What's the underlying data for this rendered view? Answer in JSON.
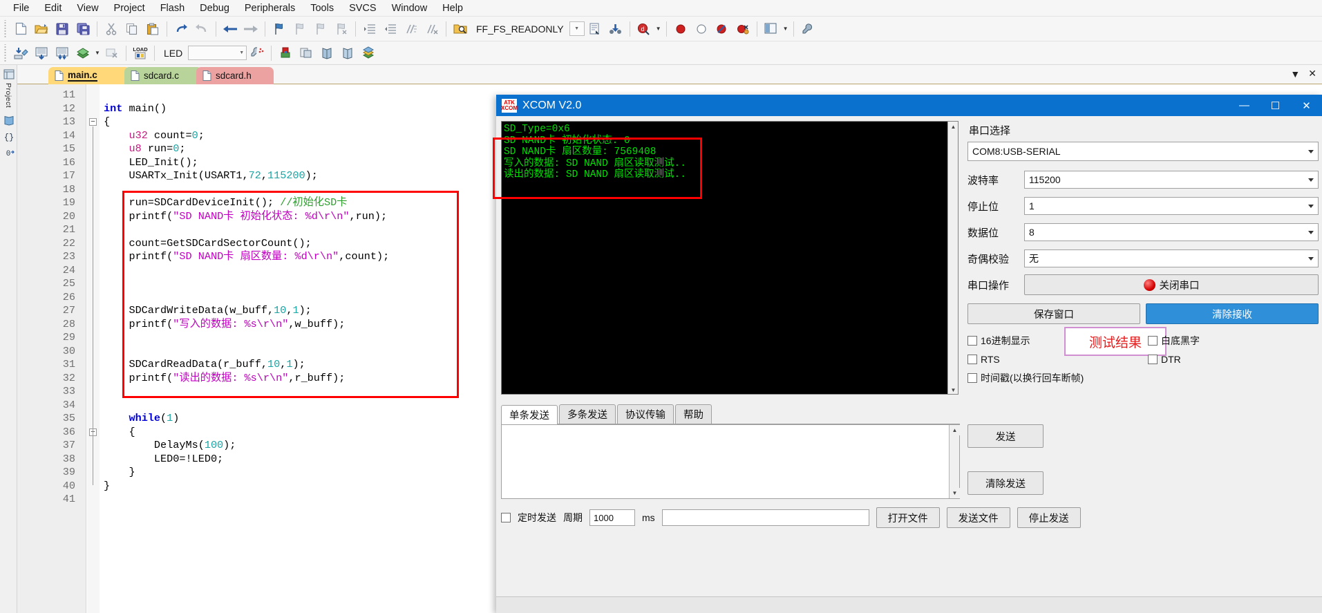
{
  "menubar": {
    "items": [
      "File",
      "Edit",
      "View",
      "Project",
      "Flash",
      "Debug",
      "Peripherals",
      "Tools",
      "SVCS",
      "Window",
      "Help"
    ]
  },
  "toolbar1": {
    "define_label": "FF_FS_READONLY",
    "icons": [
      "new-file-icon",
      "open-folder-icon",
      "save-icon",
      "save-all-icon",
      "cut-icon",
      "copy-icon",
      "paste-icon",
      "undo-icon",
      "redo-icon",
      "navigate-back-icon",
      "navigate-forward-icon",
      "bookmark-toggle-icon",
      "bookmark-prev-icon",
      "bookmark-next-icon",
      "bookmark-clear-icon",
      "indent-icon",
      "outdent-icon",
      "comment-icon",
      "uncomment-icon",
      "find-in-files-icon",
      "combo-dropdown-icon",
      "source-browser-icon",
      "binocular-icon",
      "debug-session-icon",
      "breakpoint-insert-icon",
      "breakpoint-disable-icon",
      "breakpoint-disable-all-icon",
      "breakpoint-kill-all-icon",
      "window-layout-icon",
      "configure-icon"
    ]
  },
  "toolbar2": {
    "target_label": "LED",
    "icons": [
      "translate-icon",
      "build-icon",
      "rebuild-icon",
      "batch-build-icon",
      "batch-build-dropdown-icon",
      "stop-build-icon",
      "load-icon",
      "target-combo-icon",
      "options-target-icon",
      "manage-components-icon",
      "multi-project-icon",
      "book-icon",
      "book2-icon",
      "packinstaller-icon"
    ]
  },
  "leftdock": {
    "items": [
      "project-panel",
      "books-panel",
      "functions-panel",
      "templates-panel"
    ],
    "label": "Project"
  },
  "tabs": [
    {
      "label": "main.c",
      "name": "tab-main-c",
      "active": true
    },
    {
      "label": "sdcard.c",
      "name": "tab-sdcard-c",
      "active": false
    },
    {
      "label": "sdcard.h",
      "name": "tab-sdcard-h",
      "active": false
    }
  ],
  "tabbar_right": {
    "dropdown": "▼",
    "close": "✕"
  },
  "editor": {
    "first_line": 11,
    "lines": [
      {
        "n": 11,
        "tokens": []
      },
      {
        "n": 12,
        "tokens": [
          {
            "t": "kw",
            "v": "int"
          },
          {
            "t": "pln",
            "v": " main()"
          }
        ]
      },
      {
        "n": 13,
        "tokens": [
          {
            "t": "pln",
            "v": "{"
          }
        ],
        "fold": true
      },
      {
        "n": 14,
        "tokens": [
          {
            "t": "pln",
            "v": "    "
          },
          {
            "t": "typ",
            "v": "u32"
          },
          {
            "t": "pln",
            "v": " count="
          },
          {
            "t": "num",
            "v": "0"
          },
          {
            "t": "pln",
            "v": ";"
          }
        ]
      },
      {
        "n": 15,
        "tokens": [
          {
            "t": "pln",
            "v": "    "
          },
          {
            "t": "typ",
            "v": "u8"
          },
          {
            "t": "pln",
            "v": " run="
          },
          {
            "t": "num",
            "v": "0"
          },
          {
            "t": "pln",
            "v": ";"
          }
        ]
      },
      {
        "n": 16,
        "tokens": [
          {
            "t": "pln",
            "v": "    LED_Init();"
          }
        ]
      },
      {
        "n": 17,
        "tokens": [
          {
            "t": "pln",
            "v": "    USARTx_Init(USART1,"
          },
          {
            "t": "num",
            "v": "72"
          },
          {
            "t": "pln",
            "v": ","
          },
          {
            "t": "num",
            "v": "115200"
          },
          {
            "t": "pln",
            "v": ");"
          }
        ]
      },
      {
        "n": 18,
        "tokens": []
      },
      {
        "n": 19,
        "tokens": [
          {
            "t": "pln",
            "v": "    run=SDCardDeviceInit(); "
          },
          {
            "t": "cmt",
            "v": "//初始化SD卡"
          }
        ]
      },
      {
        "n": 20,
        "tokens": [
          {
            "t": "pln",
            "v": "    printf("
          },
          {
            "t": "str",
            "v": "\"SD NAND卡 初始化状态: %d\\r\\n\""
          },
          {
            "t": "pln",
            "v": ",run);"
          }
        ]
      },
      {
        "n": 21,
        "tokens": []
      },
      {
        "n": 22,
        "tokens": [
          {
            "t": "pln",
            "v": "    count=GetSDCardSectorCount();"
          }
        ]
      },
      {
        "n": 23,
        "tokens": [
          {
            "t": "pln",
            "v": "    printf("
          },
          {
            "t": "str",
            "v": "\"SD NAND卡 扇区数量: %d\\r\\n\""
          },
          {
            "t": "pln",
            "v": ",count);"
          }
        ]
      },
      {
        "n": 24,
        "tokens": []
      },
      {
        "n": 25,
        "tokens": []
      },
      {
        "n": 26,
        "tokens": []
      },
      {
        "n": 27,
        "tokens": [
          {
            "t": "pln",
            "v": "    SDCardWriteData(w_buff,"
          },
          {
            "t": "num",
            "v": "10"
          },
          {
            "t": "pln",
            "v": ","
          },
          {
            "t": "num",
            "v": "1"
          },
          {
            "t": "pln",
            "v": ");"
          }
        ]
      },
      {
        "n": 28,
        "tokens": [
          {
            "t": "pln",
            "v": "    printf("
          },
          {
            "t": "str",
            "v": "\"写入的数据: %s\\r\\n\""
          },
          {
            "t": "pln",
            "v": ",w_buff);"
          }
        ]
      },
      {
        "n": 29,
        "tokens": []
      },
      {
        "n": 30,
        "tokens": []
      },
      {
        "n": 31,
        "tokens": [
          {
            "t": "pln",
            "v": "    SDCardReadData(r_buff,"
          },
          {
            "t": "num",
            "v": "10"
          },
          {
            "t": "pln",
            "v": ","
          },
          {
            "t": "num",
            "v": "1"
          },
          {
            "t": "pln",
            "v": ");"
          }
        ]
      },
      {
        "n": 32,
        "tokens": [
          {
            "t": "pln",
            "v": "    printf("
          },
          {
            "t": "str",
            "v": "\"读出的数据: %s\\r\\n\""
          },
          {
            "t": "pln",
            "v": ",r_buff);"
          }
        ]
      },
      {
        "n": 33,
        "tokens": []
      },
      {
        "n": 34,
        "tokens": []
      },
      {
        "n": 35,
        "tokens": [
          {
            "t": "pln",
            "v": "    "
          },
          {
            "t": "kw",
            "v": "while"
          },
          {
            "t": "pln",
            "v": "("
          },
          {
            "t": "num",
            "v": "1"
          },
          {
            "t": "pln",
            "v": ")"
          }
        ]
      },
      {
        "n": 36,
        "tokens": [
          {
            "t": "pln",
            "v": "    {"
          }
        ],
        "fold": true
      },
      {
        "n": 37,
        "tokens": [
          {
            "t": "pln",
            "v": "        DelayMs("
          },
          {
            "t": "num",
            "v": "100"
          },
          {
            "t": "pln",
            "v": ");"
          }
        ]
      },
      {
        "n": 38,
        "tokens": [
          {
            "t": "pln",
            "v": "        LED0=!LED0;"
          }
        ]
      },
      {
        "n": 39,
        "tokens": [
          {
            "t": "pln",
            "v": "    }"
          }
        ]
      },
      {
        "n": 40,
        "tokens": [
          {
            "t": "pln",
            "v": "}"
          }
        ]
      },
      {
        "n": 41,
        "tokens": []
      }
    ]
  },
  "xcom": {
    "title": "XCOM V2.0",
    "logo_line1": "ATK",
    "logo_line2": "XCOM",
    "window_buttons": {
      "minimize": "—",
      "maximize": "☐",
      "close": "✕"
    },
    "terminal_lines": [
      "SD_Type=0x6",
      "SD NAND卡 初始化状态: 0",
      "SD NAND卡 扇区数量: 7569408",
      "写入的数据: SD NAND 扇区读取测试..",
      "读出的数据: SD NAND 扇区读取测试.."
    ],
    "result_badge": "测试结果",
    "settings": {
      "section_title": "串口选择",
      "port": "COM8:USB-SERIAL",
      "rows": [
        {
          "label": "波特率",
          "value": "115200"
        },
        {
          "label": "停止位",
          "value": "1"
        },
        {
          "label": "数据位",
          "value": "8"
        },
        {
          "label": "奇偶校验",
          "value": "无"
        }
      ],
      "operation_label": "串口操作",
      "operation_button": "关闭串口",
      "save_button": "保存窗口",
      "clear_button": "清除接收",
      "checkboxes": [
        "16进制显示",
        "白底黑字",
        "RTS",
        "DTR",
        "时间戳(以换行回车断帧)"
      ]
    },
    "send_tabs": [
      "单条发送",
      "多条发送",
      "协议传输",
      "帮助"
    ],
    "send_input": "",
    "send_buttons": [
      "发送",
      "清除发送"
    ],
    "bottom": {
      "timed_send_label": "定时发送",
      "period_label": "周期",
      "period_value": "1000",
      "ms_label": "ms",
      "open_file_button": "打开文件",
      "send_file_button": "发送文件",
      "stop_send_button": "停止发送"
    }
  }
}
